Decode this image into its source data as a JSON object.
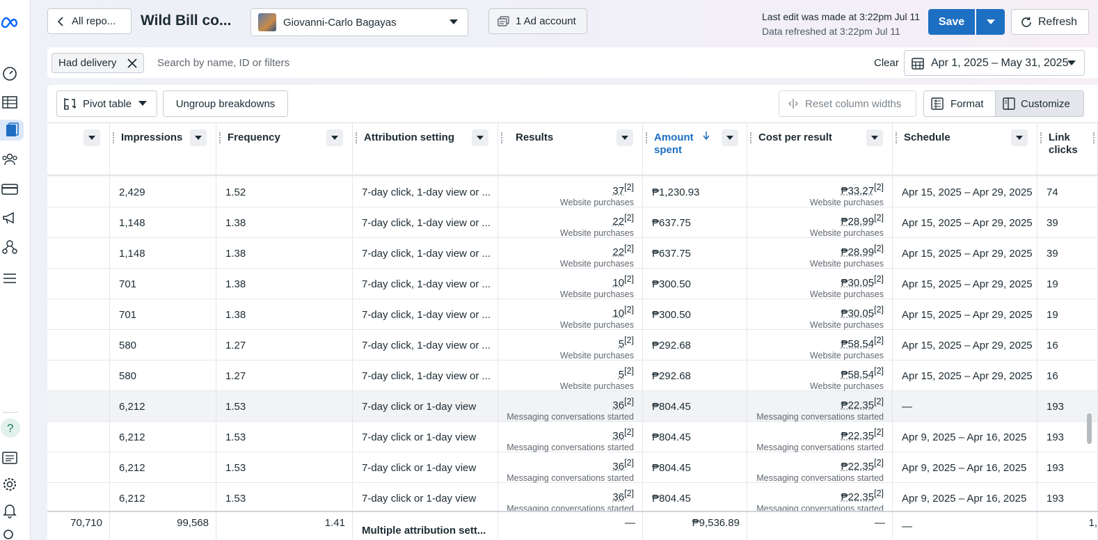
{
  "header": {
    "back_label": "All repo...",
    "report_title": "Wild Bill co...",
    "account_name": "Giovanni-Carlo Bagayas",
    "ad_account_label": "1 Ad account",
    "last_edit": "Last edit was made at 3:22pm Jul 11",
    "data_refreshed": "Data refreshed at 3:22pm Jul 11",
    "save_label": "Save",
    "refresh_label": "Refresh"
  },
  "filters": {
    "chip_label": "Had delivery",
    "search_placeholder": "Search by name, ID or filters",
    "clear_label": "Clear",
    "date_range": "Apr 1, 2025 – May 31, 2025"
  },
  "toolbar": {
    "pivot_label": "Pivot table",
    "ungroup_label": "Ungroup breakdowns",
    "reset_label": "Reset column widths",
    "format_label": "Format",
    "customize_label": "Customize"
  },
  "columns": {
    "impressions": "Impressions",
    "frequency": "Frequency",
    "attribution": "Attribution setting",
    "results": "Results",
    "amount_spent_1": "Amount",
    "amount_spent_2": "spent",
    "cost_per_result": "Cost per result",
    "schedule": "Schedule",
    "link_clicks_1": "Link",
    "link_clicks_2": "clicks"
  },
  "rows": [
    {
      "impressions": "2,429",
      "frequency": "1.52",
      "attribution": "7-day click, 1-day view or ...",
      "results": "37",
      "results_label": "Website purchases",
      "amount": "₱1,230.93",
      "cpr": "₱33.27",
      "cpr_label": "Website purchases",
      "schedule": "Apr 15, 2025 – Apr 29, 2025",
      "link_clicks": "74",
      "highlight": false
    },
    {
      "impressions": "1,148",
      "frequency": "1.38",
      "attribution": "7-day click, 1-day view or ...",
      "results": "22",
      "results_label": "Website purchases",
      "amount": "₱637.75",
      "cpr": "₱28.99",
      "cpr_label": "Website purchases",
      "schedule": "Apr 15, 2025 – Apr 29, 2025",
      "link_clicks": "39",
      "highlight": false
    },
    {
      "impressions": "1,148",
      "frequency": "1.38",
      "attribution": "7-day click, 1-day view or ...",
      "results": "22",
      "results_label": "Website purchases",
      "amount": "₱637.75",
      "cpr": "₱28.99",
      "cpr_label": "Website purchases",
      "schedule": "Apr 15, 2025 – Apr 29, 2025",
      "link_clicks": "39",
      "highlight": false
    },
    {
      "impressions": "701",
      "frequency": "1.38",
      "attribution": "7-day click, 1-day view or ...",
      "results": "10",
      "results_label": "Website purchases",
      "amount": "₱300.50",
      "cpr": "₱30.05",
      "cpr_label": "Website purchases",
      "schedule": "Apr 15, 2025 – Apr 29, 2025",
      "link_clicks": "19",
      "highlight": false
    },
    {
      "impressions": "701",
      "frequency": "1.38",
      "attribution": "7-day click, 1-day view or ...",
      "results": "10",
      "results_label": "Website purchases",
      "amount": "₱300.50",
      "cpr": "₱30.05",
      "cpr_label": "Website purchases",
      "schedule": "Apr 15, 2025 – Apr 29, 2025",
      "link_clicks": "19",
      "highlight": false
    },
    {
      "impressions": "580",
      "frequency": "1.27",
      "attribution": "7-day click, 1-day view or ...",
      "results": "5",
      "results_label": "Website purchases",
      "amount": "₱292.68",
      "cpr": "₱58.54",
      "cpr_label": "Website purchases",
      "schedule": "Apr 15, 2025 – Apr 29, 2025",
      "link_clicks": "16",
      "highlight": false
    },
    {
      "impressions": "580",
      "frequency": "1.27",
      "attribution": "7-day click, 1-day view or ...",
      "results": "5",
      "results_label": "Website purchases",
      "amount": "₱292.68",
      "cpr": "₱58.54",
      "cpr_label": "Website purchases",
      "schedule": "Apr 15, 2025 – Apr 29, 2025",
      "link_clicks": "16",
      "highlight": false
    },
    {
      "impressions": "6,212",
      "frequency": "1.53",
      "attribution": "7-day click or 1-day view",
      "results": "36",
      "results_label": "Messaging conversations started",
      "amount": "₱804.45",
      "cpr": "₱22.35",
      "cpr_label": "Messaging conversations started",
      "schedule": "—",
      "link_clicks": "193",
      "highlight": true
    },
    {
      "impressions": "6,212",
      "frequency": "1.53",
      "attribution": "7-day click or 1-day view",
      "results": "36",
      "results_label": "Messaging conversations started",
      "amount": "₱804.45",
      "cpr": "₱22.35",
      "cpr_label": "Messaging conversations started",
      "schedule": "Apr 9, 2025 – Apr 16, 2025",
      "link_clicks": "193",
      "highlight": false
    },
    {
      "impressions": "6,212",
      "frequency": "1.53",
      "attribution": "7-day click or 1-day view",
      "results": "36",
      "results_label": "Messaging conversations started",
      "amount": "₱804.45",
      "cpr": "₱22.35",
      "cpr_label": "Messaging conversations started",
      "schedule": "Apr 9, 2025 – Apr 16, 2025",
      "link_clicks": "193",
      "highlight": false
    },
    {
      "impressions": "6,212",
      "frequency": "1.53",
      "attribution": "7-day click or 1-day view",
      "results": "36",
      "results_label": "Messaging conversations started",
      "amount": "₱804.45",
      "cpr": "₱22.35",
      "cpr_label": "Messaging conversations started",
      "schedule": "Apr 9, 2025 – Apr 16, 2025",
      "link_clicks": "193",
      "highlight": false
    }
  ],
  "results_info_marker": "[2]",
  "totals": {
    "reach": "70,710",
    "impressions": "99,568",
    "frequency": "1.41",
    "attribution": "Multiple attribution sett...",
    "results": "—",
    "amount": "₱9,536.89",
    "cpr": "—",
    "schedule": "—",
    "link_clicks": "1,"
  },
  "colors": {
    "primary_blue": "#1d6fc2",
    "active_nav_bg": "#dbe7fb"
  }
}
